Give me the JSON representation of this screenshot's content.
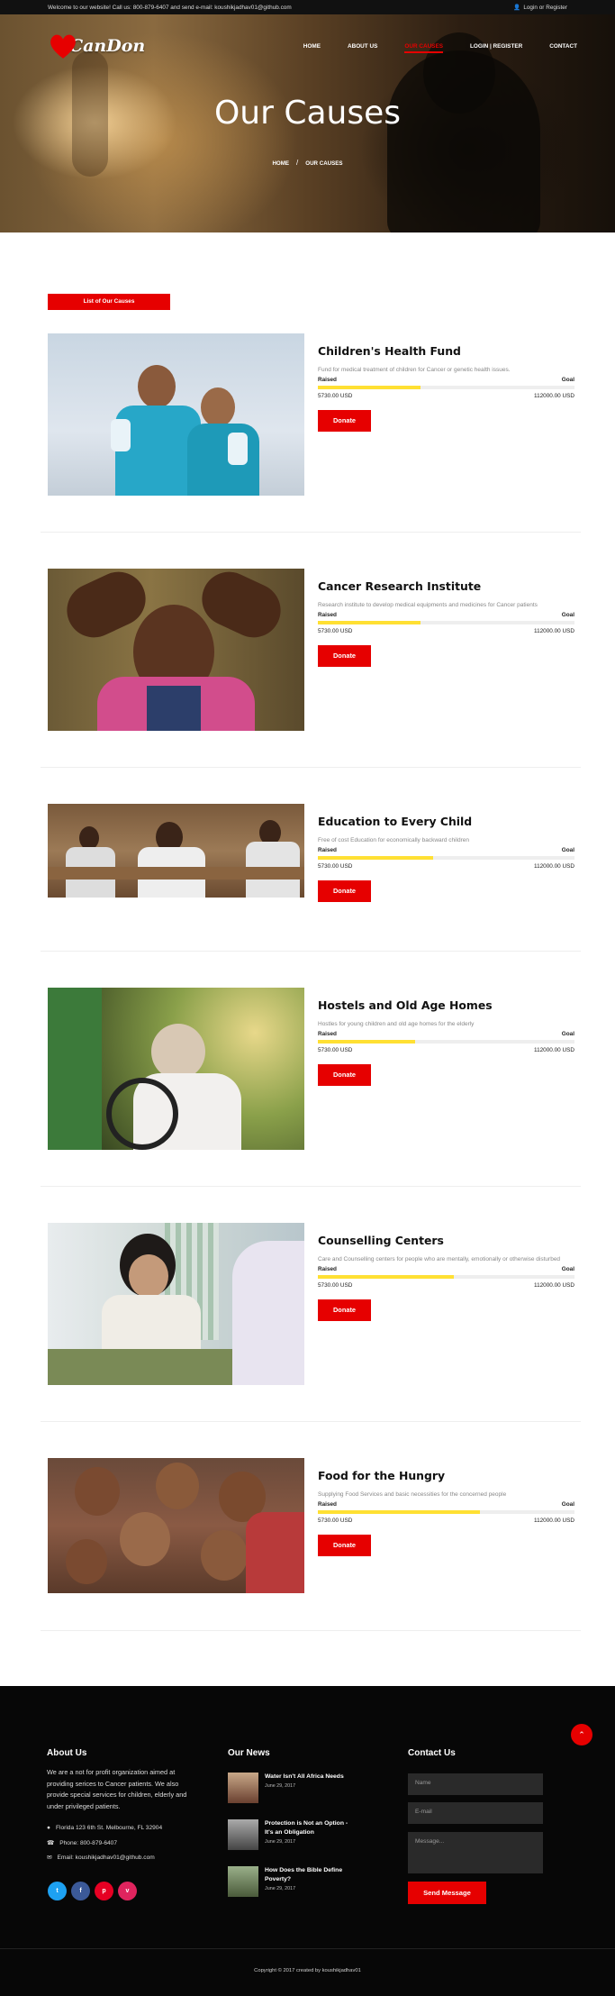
{
  "topbar": {
    "welcome": "Welcome to our website! Call us: 800-879-6407 and send e-mail: koushikjadhav01@github.com",
    "login": "Login or Register",
    "user_icon": "user-icon"
  },
  "brand": {
    "name": "CanDon",
    "logo_color": "#e60000"
  },
  "nav": {
    "home": "HOME",
    "about": "ABOUT US",
    "causes": "OUR CAUSES",
    "login": "LOGIN | REGISTER",
    "contact": "CONTACT"
  },
  "hero": {
    "title": "Our Causes",
    "breadcrumb_home": "HOME",
    "breadcrumb_sep": "/",
    "breadcrumb_current": "OUR CAUSES"
  },
  "list_button": "List of Our Causes",
  "accent_color": "#e60000",
  "progress_color": "#ffe033",
  "causes": [
    {
      "title": "Children's Health Fund",
      "desc": "Fund for medical treatment of children for Cancer or genetic health issues.",
      "raised_label": "Raised",
      "goal_label": "Goal",
      "raised": "5730.00 USD",
      "goal": "112000.00 USD",
      "progress": 0.4,
      "donate": "Donate"
    },
    {
      "title": "Cancer Research Institute",
      "desc": "Research institute to develop medical equipments and medicines for Cancer patients",
      "raised_label": "Raised",
      "goal_label": "Goal",
      "raised": "5730.00 USD",
      "goal": "112000.00 USD",
      "progress": 0.4,
      "donate": "Donate"
    },
    {
      "title": "Education to Every Child",
      "desc": "Free of cost Education for economically backward children",
      "raised_label": "Raised",
      "goal_label": "Goal",
      "raised": "5730.00 USD",
      "goal": "112000.00 USD",
      "progress": 0.45,
      "donate": "Donate"
    },
    {
      "title": "Hostels and Old Age Homes",
      "desc": "Hostles for young children and old age homes for the elderly",
      "raised_label": "Raised",
      "goal_label": "Goal",
      "raised": "5730.00 USD",
      "goal": "112000.00 USD",
      "progress": 0.38,
      "donate": "Donate"
    },
    {
      "title": "Counselling Centers",
      "desc": "Care and Counselling centers for people who are mentally, emotionally or otherwise disturbed",
      "raised_label": "Raised",
      "goal_label": "Goal",
      "raised": "5730.00 USD",
      "goal": "112000.00 USD",
      "progress": 0.53,
      "donate": "Donate"
    },
    {
      "title": "Food for the Hungry",
      "desc": "Supplying Food Services and basic necessities for the concerned people",
      "raised_label": "Raised",
      "goal_label": "Goal",
      "raised": "5730.00 USD",
      "goal": "112000.00 USD",
      "progress": 0.63,
      "donate": "Donate"
    }
  ],
  "footer": {
    "about_title": "About Us",
    "about_text": "We are a not for profit organization aimed at providing serices to Cancer patients. We also provide special services for children, elderly and under privileged patients.",
    "address": "Florida 123 6th St. Melbourne, FL 32904",
    "phone": "Phone: 800-879-6407",
    "email": "Email: koushikjadhav01@github.com",
    "social": [
      {
        "label": "t",
        "icon": "twitter-icon",
        "color": "#1da1f2"
      },
      {
        "label": "f",
        "icon": "facebook-icon",
        "color": "#3b5998"
      },
      {
        "label": "p",
        "icon": "pinterest-icon",
        "color": "#e60023"
      },
      {
        "label": "v",
        "icon": "vimeo-icon",
        "color": "#e0245e"
      }
    ],
    "news_title": "Our News",
    "news": [
      {
        "title": "Water Isn't All Africa Needs",
        "date": "June 29, 2017"
      },
      {
        "title": "Protection is Not an Option - It's an Obligation",
        "date": "June 29, 2017"
      },
      {
        "title": "How Does the Bible Define Poverty?",
        "date": "June 29, 2017"
      }
    ],
    "contact_title": "Contact Us",
    "name_placeholder": "Name",
    "email_placeholder": "E-mail",
    "message_placeholder": "Message...",
    "send": "Send Message",
    "copyright": "Copyright © 2017 created by koushikjadhav01"
  }
}
